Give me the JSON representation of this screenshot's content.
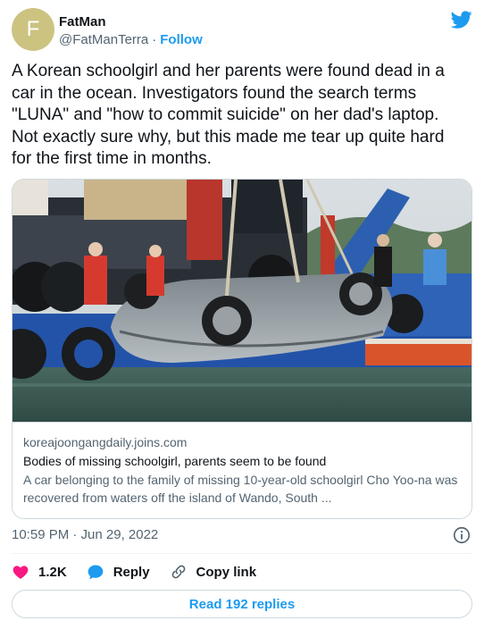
{
  "author": {
    "avatar_letter": "F",
    "avatar_color": "#ccc381",
    "name": "FatMan",
    "handle": "@FatManTerra",
    "separator": "·",
    "follow_label": "Follow"
  },
  "tweet": {
    "text": "A Korean schoolgirl and her parents were found dead in a\ncar in the ocean. Investigators found the search terms\n\"LUNA\" and \"how to commit suicide\" on her dad's laptop.\nNot exactly sure why, but this made me tear up quite hard\nfor the first time in months."
  },
  "link_card": {
    "domain": "koreajoongangdaily.joins.com",
    "title": "Bodies of missing schoolgirl, parents seem to be found",
    "description": "A car belonging to the family of missing 10-year-old schoolgirl Cho Yoo-na was recovered from waters off the island of Wando, South ..."
  },
  "timestamp": "10:59 PM · Jun 29, 2022",
  "actions": {
    "like_count": "1.2K",
    "reply_label": "Reply",
    "copy_link_label": "Copy link"
  },
  "read_replies_label": "Read 192 replies",
  "colors": {
    "accent": "#1d9bf0",
    "like": "#f91880",
    "text_secondary": "#536471",
    "border": "#cfd9de"
  }
}
